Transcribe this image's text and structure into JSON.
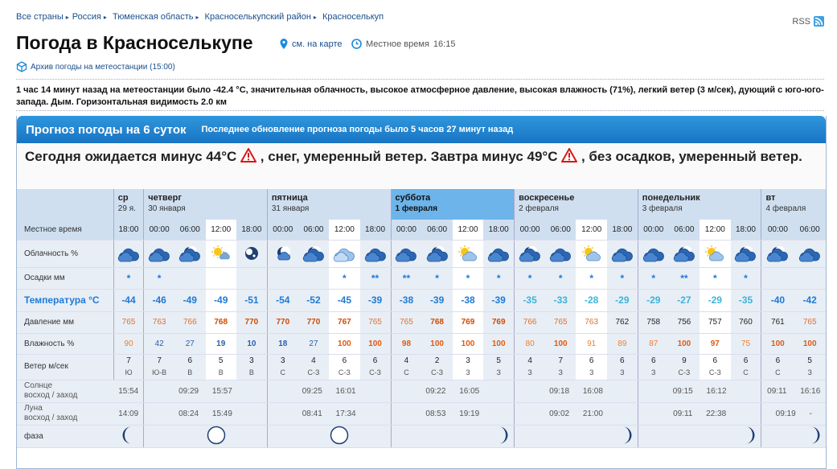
{
  "breadcrumbs": [
    "Все страны",
    "Россия",
    "Тюменская область",
    "Красноселькупский район",
    "Красноселькуп"
  ],
  "rss": "RSS",
  "title": "Погода в Красноселькупе",
  "map_link": "см. на карте",
  "local_time_label": "Местное время",
  "local_time": "16:15",
  "archive_link": "Архив погоды на метеостанции (15:00)",
  "observation": "1 час 14 минут назад на метеостанции было -42.4 °С, значительная облачность, высокое атмосферное давление, высокая влажность (71%), легкий ветер (3 м/сек), дующий с юго-юго-запада. Дым. Горизонтальная видимость 2.0 км",
  "forecast": {
    "title": "Прогноз погоды на 6 суток",
    "updated": "Последнее обновление прогноза погоды было 5 часов 27 минут назад",
    "summary_a": "Сегодня ожидается минус 44°С",
    "summary_b": ", снег, умеренный ветер. Завтра минус 49°С",
    "summary_c": ", без осадков, умеренный ветер."
  },
  "labels": {
    "time": "Местное время",
    "cloud": "Облачность %",
    "prec": "Осадки мм",
    "temp": "Температура °С",
    "pres": "Давление мм",
    "hum": "Влажность %",
    "wind": "Ветер м/сек",
    "sun_a": "Солнце",
    "sun_b": "восход / заход",
    "moon_a": "Луна",
    "moon_b": "восход / заход",
    "phase": "фаза"
  },
  "days": [
    {
      "name": "ср",
      "date": "29 я."
    },
    {
      "name": "четверг",
      "date": "30 января"
    },
    {
      "name": "пятница",
      "date": "31 января"
    },
    {
      "name": "суббота",
      "date": "1 февраля"
    },
    {
      "name": "воскресенье",
      "date": "2 февраля"
    },
    {
      "name": "понедельник",
      "date": "3 февраля"
    },
    {
      "name": "вт",
      "date": "4 февраля"
    }
  ],
  "columns": [
    {
      "time": "18:00",
      "temp": "-44",
      "pres": "765",
      "hum": "90",
      "wind": "7",
      "dir": "Ю",
      "snow": "*",
      "icon": "cloud-night"
    },
    {
      "time": "00:00",
      "temp": "-46",
      "pres": "763",
      "hum": "42",
      "wind": "7",
      "dir": "Ю-В",
      "snow": "*",
      "icon": "cloud-night"
    },
    {
      "time": "06:00",
      "temp": "-49",
      "pres": "766",
      "hum": "27",
      "wind": "6",
      "dir": "В",
      "snow": "",
      "icon": "partly-night"
    },
    {
      "time": "12:00",
      "temp": "-49",
      "pres": "768",
      "hum": "19",
      "wind": "5",
      "dir": "В",
      "snow": "",
      "icon": "sun"
    },
    {
      "time": "18:00",
      "temp": "-51",
      "pres": "770",
      "hum": "10",
      "wind": "3",
      "dir": "В",
      "snow": "",
      "icon": "moon"
    },
    {
      "time": "00:00",
      "temp": "-54",
      "pres": "770",
      "hum": "18",
      "wind": "3",
      "dir": "С",
      "snow": "",
      "icon": "moon-cloud"
    },
    {
      "time": "06:00",
      "temp": "-52",
      "pres": "770",
      "hum": "27",
      "wind": "4",
      "dir": "С-З",
      "snow": "",
      "icon": "partly-night"
    },
    {
      "time": "12:00",
      "temp": "-45",
      "pres": "767",
      "hum": "100",
      "wind": "6",
      "dir": "С-З",
      "snow": "*",
      "icon": "cloud-day"
    },
    {
      "time": "18:00",
      "temp": "-39",
      "pres": "765",
      "hum": "100",
      "wind": "6",
      "dir": "С-З",
      "snow": "**",
      "icon": "cloud-night"
    },
    {
      "time": "00:00",
      "temp": "-38",
      "pres": "765",
      "hum": "98",
      "wind": "4",
      "dir": "С",
      "snow": "**",
      "icon": "cloud-night"
    },
    {
      "time": "06:00",
      "temp": "-39",
      "pres": "768",
      "hum": "100",
      "wind": "2",
      "dir": "С-З",
      "snow": "*",
      "icon": "partly-night"
    },
    {
      "time": "12:00",
      "temp": "-38",
      "pres": "769",
      "hum": "100",
      "wind": "3",
      "dir": "З",
      "snow": "*",
      "icon": "sun-cloud"
    },
    {
      "time": "18:00",
      "temp": "-39",
      "pres": "769",
      "hum": "100",
      "wind": "5",
      "dir": "З",
      "snow": "*",
      "icon": "cloud-night"
    },
    {
      "time": "00:00",
      "temp": "-35",
      "pres": "766",
      "hum": "80",
      "wind": "4",
      "dir": "З",
      "snow": "*",
      "icon": "partly-night"
    },
    {
      "time": "06:00",
      "temp": "-33",
      "pres": "765",
      "hum": "100",
      "wind": "7",
      "dir": "З",
      "snow": "*",
      "icon": "cloud-night"
    },
    {
      "time": "12:00",
      "temp": "-28",
      "pres": "763",
      "hum": "91",
      "wind": "6",
      "dir": "З",
      "snow": "*",
      "icon": "sun-cloud"
    },
    {
      "time": "18:00",
      "temp": "-29",
      "pres": "762",
      "hum": "89",
      "wind": "6",
      "dir": "З",
      "snow": "*",
      "icon": "cloud-night"
    },
    {
      "time": "00:00",
      "temp": "-29",
      "pres": "758",
      "hum": "87",
      "wind": "6",
      "dir": "З",
      "snow": "*",
      "icon": "cloud-night"
    },
    {
      "time": "06:00",
      "temp": "-27",
      "pres": "756",
      "hum": "100",
      "wind": "9",
      "dir": "С-З",
      "snow": "**",
      "icon": "partly-night"
    },
    {
      "time": "12:00",
      "temp": "-29",
      "pres": "757",
      "hum": "97",
      "wind": "6",
      "dir": "С-З",
      "snow": "*",
      "icon": "sun-cloud"
    },
    {
      "time": "18:00",
      "temp": "-35",
      "pres": "760",
      "hum": "75",
      "wind": "6",
      "dir": "С",
      "snow": "*",
      "icon": "partly-night"
    },
    {
      "time": "00:00",
      "temp": "-40",
      "pres": "761",
      "hum": "100",
      "wind": "6",
      "dir": "С",
      "snow": "",
      "icon": "partly-night"
    },
    {
      "time": "06:00",
      "temp": "-42",
      "pres": "765",
      "hum": "100",
      "wind": "5",
      "dir": "З",
      "snow": "",
      "icon": "cloud-night"
    }
  ],
  "astro": [
    {
      "sun": "15:54",
      "moon": "14:09",
      "phase": "waxing-crescent"
    },
    {
      "sun": "09:29 15:57",
      "moon": "08:24 15:49",
      "phase": "full"
    },
    {
      "sun": "09:25 16:01",
      "moon": "08:41 17:34",
      "phase": "full"
    },
    {
      "sun": "09:22 16:05",
      "moon": "08:53 19:19",
      "phase": "waning-crescent"
    },
    {
      "sun": "09:18 16:08",
      "moon": "09:02 21:00",
      "phase": "waning-crescent"
    },
    {
      "sun": "09:15 16:12",
      "moon": "09:11 22:38",
      "phase": "waning-crescent"
    },
    {
      "sun": "09:11 16:16",
      "moon": "09:19 -",
      "phase": "waning-crescent"
    }
  ]
}
